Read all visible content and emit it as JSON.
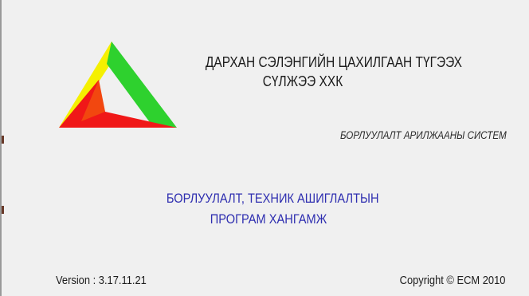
{
  "company": {
    "line1": "ДАРХАН СЭЛЭНГИЙН ЦАХИЛГААН ТҮГЭЭХ",
    "line2": "СҮЛЖЭЭ ХХК"
  },
  "system_name": "БОРЛУУЛАЛТ АРИЛЖААНЫ СИСТЕМ",
  "product": {
    "line1": "БОРЛУУЛАЛТ, ТЕХНИК АШИГЛАЛТЫН",
    "line2": "ПРОГРАМ ХАНГАМЖ"
  },
  "version_text": "Version : 3.17.11.21",
  "copyright_text": "Copyright © ECM 2010",
  "colors": {
    "background": "#f0f0f0",
    "product_title": "#2e2eb0",
    "logo_yellow": "#f5f000",
    "logo_green": "#2ed12e",
    "logo_red": "#f01818"
  },
  "logo": {
    "icon": "triangle-logo-icon"
  }
}
